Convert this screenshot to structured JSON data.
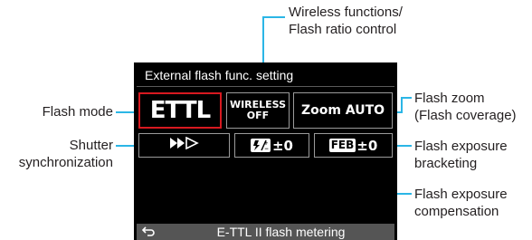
{
  "callouts": {
    "wireless_line1": "Wireless functions/",
    "wireless_line2": "Flash ratio control",
    "flash_mode": "Flash mode",
    "shutter_line1": "Shutter",
    "shutter_line2": "synchronization",
    "zoom_line1": "Flash zoom",
    "zoom_line2": "(Flash coverage)",
    "feb_line1": "Flash exposure",
    "feb_line2": "bracketing",
    "fec_line1": "Flash exposure",
    "fec_line2": "compensation"
  },
  "screen": {
    "title": "External flash func. setting",
    "flash_mode_value": "ETTL",
    "wireless_value_line1": "WIRELESS",
    "wireless_value_line2": "OFF",
    "zoom_value": "Zoom AUTO",
    "shutter_icon": "high-speed-sync-icon",
    "fec_icon_label": "☇⁄±",
    "fec_value": "±0",
    "feb_icon_label": "FEB",
    "feb_value": "±0",
    "footer_text": "E-TTL II flash metering",
    "back_icon": "return-arrow-icon"
  },
  "colors": {
    "leader_line": "#2bb6e6",
    "selection": "#d71920",
    "screen_bg": "#000000",
    "footer_bg": "#555555"
  }
}
